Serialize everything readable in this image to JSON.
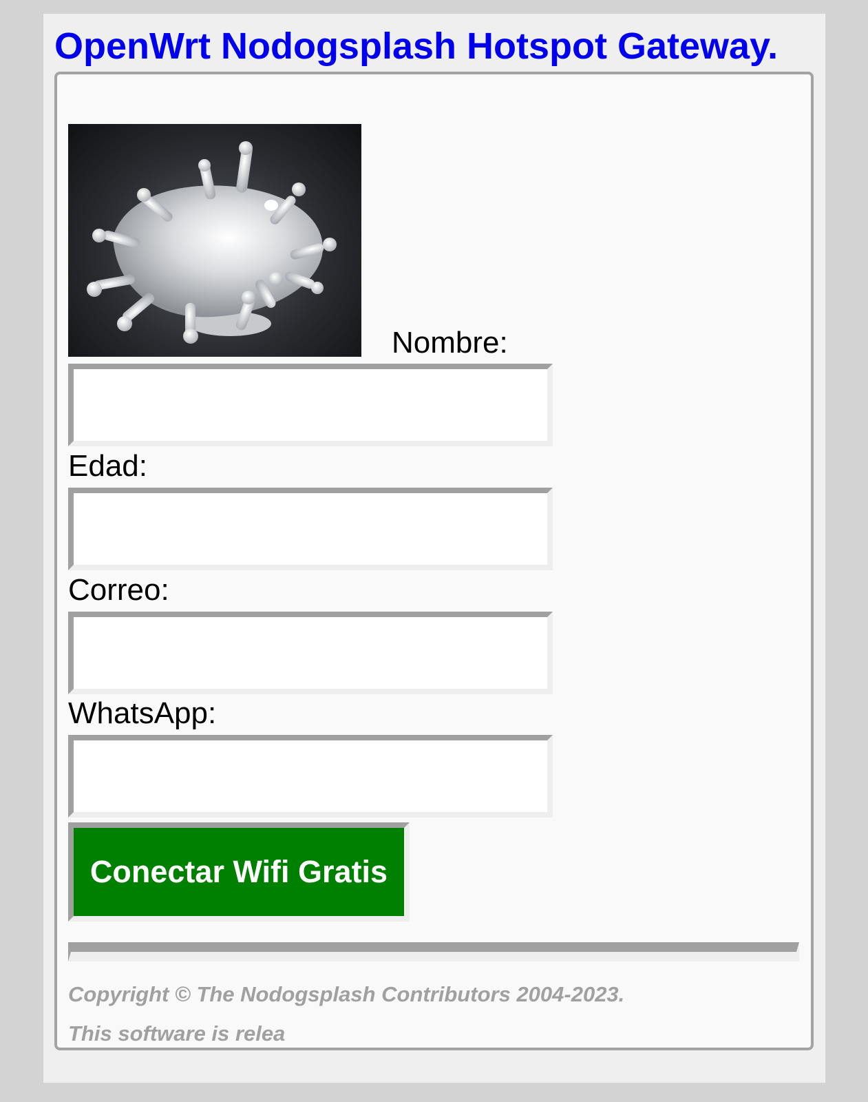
{
  "header": {
    "title": "OpenWrt Nodogsplash Hotspot Gateway."
  },
  "logo": {
    "icon": "milk-splash-image"
  },
  "form": {
    "fields": [
      {
        "label": "Nombre:",
        "value": ""
      },
      {
        "label": "Edad:",
        "value": ""
      },
      {
        "label": "Correo:",
        "value": ""
      },
      {
        "label": "WhatsApp:",
        "value": ""
      }
    ],
    "submit_label": "Conectar Wifi Gratis"
  },
  "footer": {
    "copyright": "Copyright © The Nodogsplash Contributors 2004-2023.",
    "license": "This software is relea"
  },
  "colors": {
    "title": "#0000ee",
    "button": "#008000",
    "footer_text": "#a0a0a0",
    "page_background": "#d3d3d3"
  }
}
